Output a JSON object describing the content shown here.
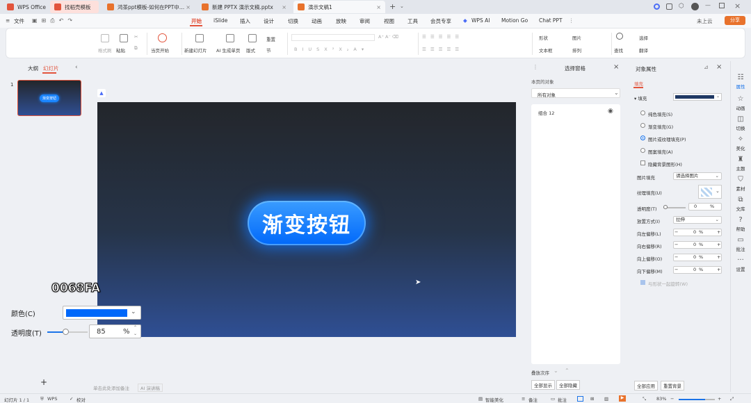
{
  "tabs": [
    {
      "label": "WPS Office",
      "active": false
    },
    {
      "label": "找稻壳模板",
      "active": false
    },
    {
      "label": "鸿茶ppt模板-如何在PPT中制作出",
      "active": false
    },
    {
      "label": "新建 PPTX 演示文稿.pptx",
      "active": false
    },
    {
      "label": "演示文稿1",
      "active": true
    }
  ],
  "titlebar": {
    "sign_in": "未上云",
    "share": "分享"
  },
  "menu": {
    "file": "文件",
    "items": [
      "开始",
      "iSlide",
      "插入",
      "设计",
      "切换",
      "动画",
      "放映",
      "审阅",
      "视图",
      "工具",
      "会员专享",
      "WPS AI",
      "Motion Go",
      "Chat PPT"
    ],
    "active": "开始"
  },
  "ribbon": {
    "format_painter": "格式刷",
    "paste": "粘贴",
    "from_current": "当页开始",
    "new_slide": "新建幻灯片",
    "ai_slide": "AI 生成单页",
    "layout": "版式",
    "reset": "重置",
    "section": "节",
    "shape": "形状",
    "picture": "图片",
    "textbox": "文本框",
    "arrange": "排列",
    "find": "查找",
    "select": "选择",
    "translate": "翻译"
  },
  "left_panel": {
    "outline": "大纲",
    "slides": "幻灯片",
    "slide_number": "1",
    "thumb_text": "渐变按钮",
    "add": "+"
  },
  "slide": {
    "button_text": "渐变按钮"
  },
  "notes": {
    "placeholder": "单击此处添加备注",
    "ai_notes": "AI 演讲稿"
  },
  "selection_pane": {
    "title": "选择窗格",
    "objects_label": "本页的对象",
    "filter": "所有对象",
    "items": [
      {
        "name": "组合 12"
      }
    ],
    "order_label": "叠放次序",
    "show_all": "全部显示",
    "hide_all": "全部隐藏"
  },
  "props": {
    "title": "对象属性",
    "tab_fill": "填充",
    "fill_header": "填充",
    "fill_color": "#1f3864",
    "options": [
      "纯色填充(S)",
      "渐变填充(G)",
      "图片或纹理填充(P)",
      "图案填充(A)"
    ],
    "selected_option": 2,
    "hide_bg": "隐藏背景图形(H)",
    "picture_fill_label": "图片填充",
    "picture_fill_value": "请选择图片",
    "texture_label": "纹理填充(U)",
    "transparency_label": "透明度(T)",
    "transparency_value": "0",
    "percent": "%",
    "placement_label": "放置方式(I)",
    "placement_value": "拉伸",
    "offsets": [
      {
        "label": "向左偏移(L)",
        "value": "0"
      },
      {
        "label": "向右偏移(R)",
        "value": "0"
      },
      {
        "label": "向上偏移(O)",
        "value": "0"
      },
      {
        "label": "向下偏移(M)",
        "value": "0"
      }
    ],
    "rotate_with_shape": "与形状一起旋转(W)",
    "apply_all": "全部应用",
    "reset_bg": "重置背景"
  },
  "right_bar": [
    "属性",
    "动画",
    "切换",
    "美化",
    "主题",
    "素材",
    "文库",
    "帮助",
    "批注",
    "设置"
  ],
  "overlay": {
    "hex": "0068FA",
    "color_label": "颜色(C)",
    "color_value": "#0068fa",
    "transparency_label": "透明度(T)",
    "transparency_value": "85",
    "percent": "%",
    "slider_level": 0.45
  },
  "status": {
    "slide_count": "幻灯片 1 / 1",
    "wps": "WPS",
    "proofing": "校对",
    "smart_beautify": "智能美化",
    "notes": "备注",
    "comments": "批注",
    "zoom": "83%"
  },
  "colors": {
    "accent": "#e2543c",
    "button_blue": "#0068fa"
  }
}
